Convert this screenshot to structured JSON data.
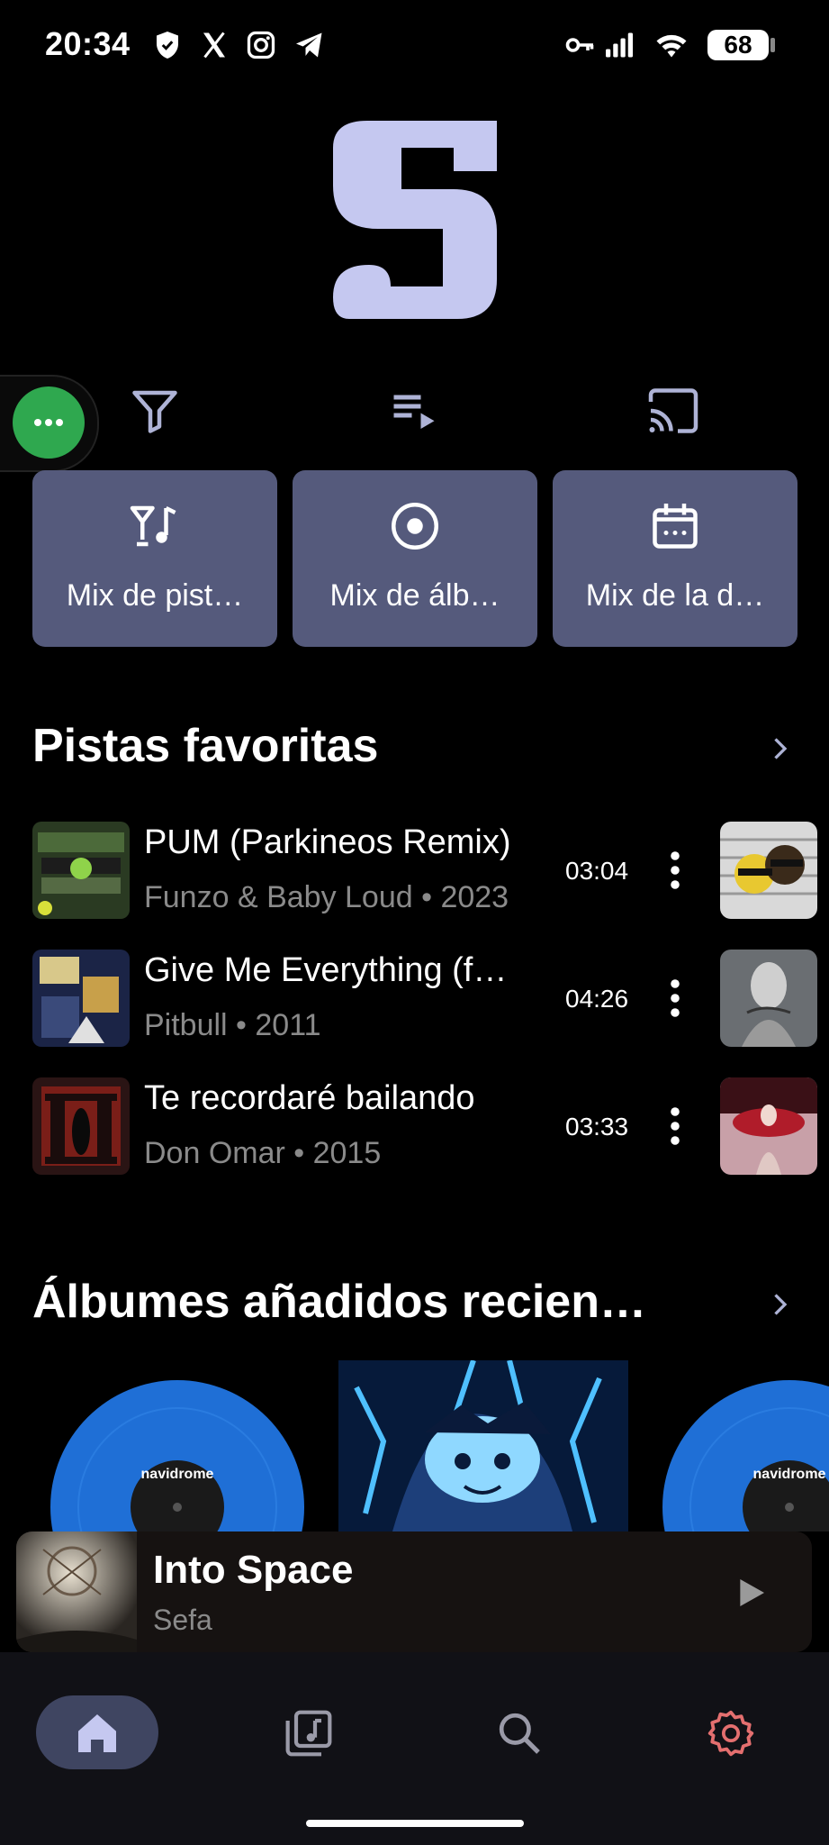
{
  "status": {
    "time": "20:34",
    "battery": "68",
    "icons": [
      "shield-icon",
      "x-icon",
      "instagram-icon",
      "telegram-icon",
      "key-icon",
      "signal-icon",
      "wifi-icon",
      "battery-icon"
    ]
  },
  "toolbar": {
    "icons": [
      "more-icon",
      "filter-icon",
      "queue-icon",
      "cast-icon"
    ]
  },
  "mixes": [
    {
      "label": "Mix de pist…",
      "icon": "glass-music-icon"
    },
    {
      "label": "Mix de álb…",
      "icon": "album-icon"
    },
    {
      "label": "Mix de la d…",
      "icon": "calendar-icon"
    }
  ],
  "favorites": {
    "title": "Pistas favoritas",
    "tracks": [
      {
        "title": "PUM (Parkineos Remix)",
        "subtitle": "Funzo & Baby Loud • 2023",
        "duration": "03:04"
      },
      {
        "title": "Give Me Everything (f…",
        "subtitle": "Pitbull • 2011",
        "duration": "04:26"
      },
      {
        "title": "Te recordaré bailando",
        "subtitle": "Don Omar • 2015",
        "duration": "03:33"
      }
    ]
  },
  "recent_albums": {
    "title": "Álbumes añadidos recien…",
    "label_text": "navidrome"
  },
  "now_playing": {
    "title": "Into Space",
    "artist": "Sefa"
  },
  "nav": {
    "items": [
      "home-icon",
      "library-icon",
      "search-icon",
      "settings-icon"
    ],
    "accent": "#e46f6f"
  },
  "colors": {
    "card": "#555a7c",
    "logo": "#c5c8f0",
    "fab": "#2fa84f",
    "vinyl": "#1f6fd6"
  }
}
